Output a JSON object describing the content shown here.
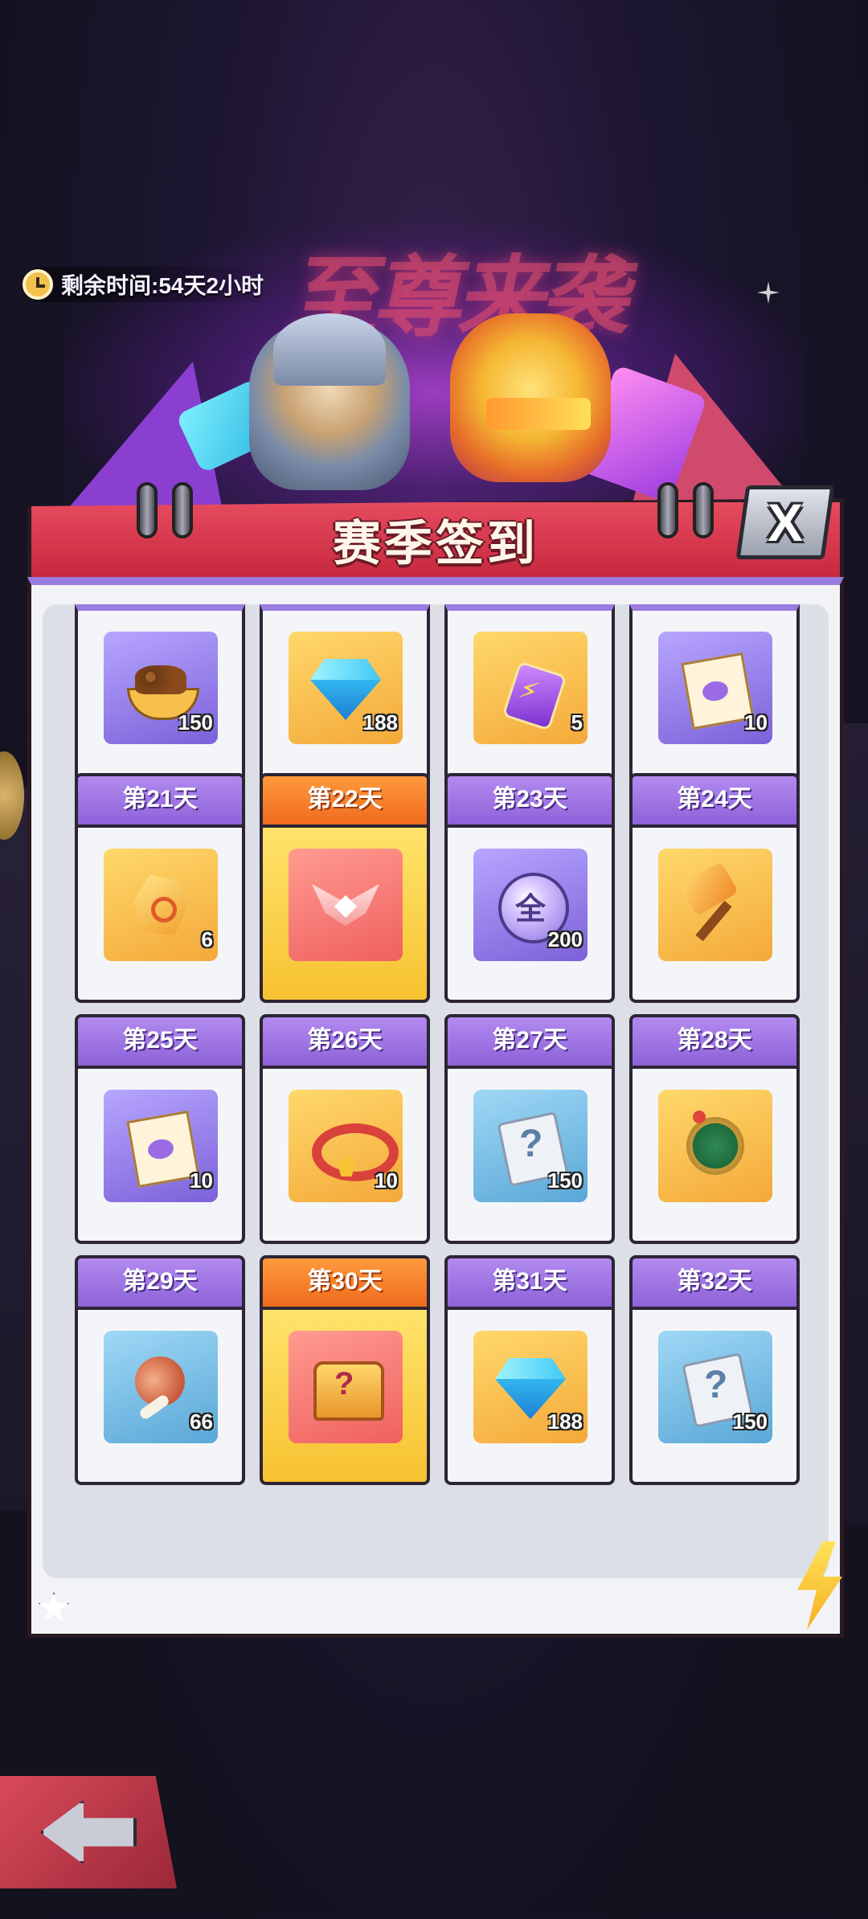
{
  "timer": {
    "label": "剩余时间:54天2小时"
  },
  "panel": {
    "title": "赛季签到",
    "close_label": "X"
  },
  "banner": {
    "title_text": "至尊来袭"
  },
  "colors": {
    "header_red": "#d9334a",
    "day_purple": "#9b6fe0",
    "day_today_orange": "#f5812a"
  },
  "rows": [
    [
      {
        "day": "",
        "item": "pet-food-icon",
        "rarity": "purple",
        "qty": "150"
      },
      {
        "day": "",
        "item": "diamond-icon",
        "rarity": "orange",
        "qty": "188"
      },
      {
        "day": "",
        "item": "energy-potion-icon",
        "rarity": "orange",
        "qty": "5"
      },
      {
        "day": "",
        "item": "integral-ticket-icon",
        "rarity": "purple",
        "qty": "10"
      }
    ],
    [
      {
        "day": "第21天",
        "item": "gold-ore-icon",
        "rarity": "orange",
        "qty": "6",
        "today": false
      },
      {
        "day": "第22天",
        "item": "wings-emblem-icon",
        "rarity": "red",
        "qty": "",
        "today": true
      },
      {
        "day": "第23天",
        "item": "all-token-icon",
        "rarity": "purple",
        "qty": "200",
        "today": false,
        "token_char": "全"
      },
      {
        "day": "第24天",
        "item": "hammer-icon",
        "rarity": "orange",
        "qty": "",
        "today": false
      }
    ],
    [
      {
        "day": "第25天",
        "item": "integral-ticket-icon",
        "rarity": "purple",
        "qty": "10",
        "today": false
      },
      {
        "day": "第26天",
        "item": "pet-collar-icon",
        "rarity": "orange",
        "qty": "10",
        "today": false
      },
      {
        "day": "第27天",
        "item": "mystery-scroll-icon",
        "rarity": "blue",
        "qty": "150",
        "today": false
      },
      {
        "day": "第28天",
        "item": "compass-icon",
        "rarity": "orange",
        "qty": "",
        "today": false
      }
    ],
    [
      {
        "day": "第29天",
        "item": "meat-icon",
        "rarity": "blue",
        "qty": "66",
        "today": false
      },
      {
        "day": "第30天",
        "item": "treasure-chest-icon",
        "rarity": "red",
        "qty": "",
        "today": true
      },
      {
        "day": "第31天",
        "item": "diamond-icon",
        "rarity": "orange",
        "qty": "188",
        "today": false
      },
      {
        "day": "第32天",
        "item": "mystery-scroll-icon",
        "rarity": "blue",
        "qty": "150",
        "today": false
      }
    ]
  ]
}
